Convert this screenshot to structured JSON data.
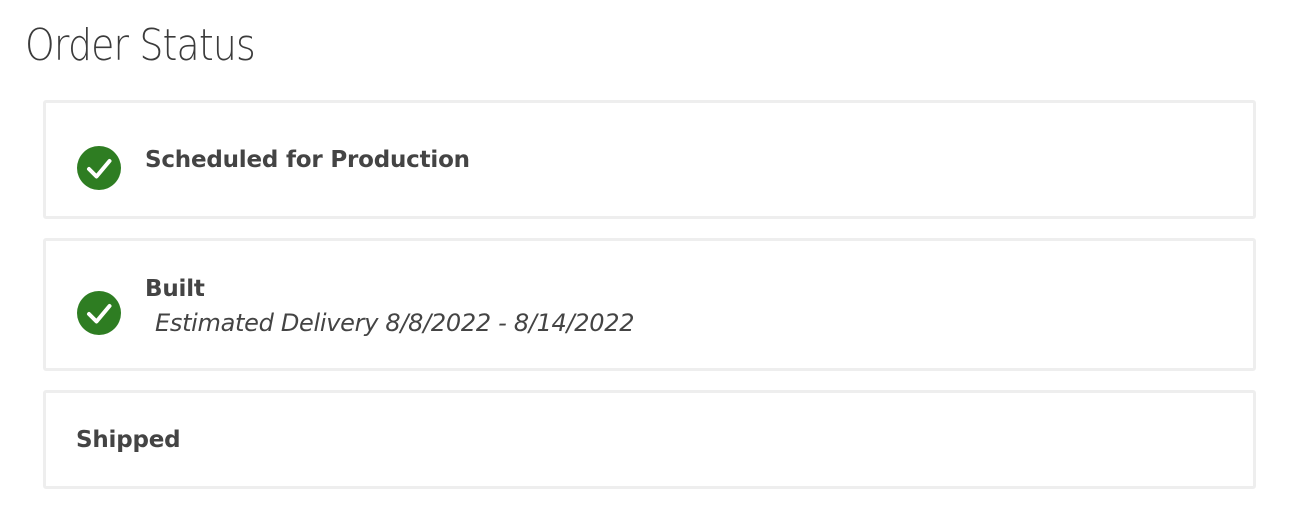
{
  "page": {
    "title": "Order Status"
  },
  "steps": [
    {
      "label": "Scheduled for Production",
      "completed": true,
      "icon": "check-circle-icon"
    },
    {
      "label": "Built",
      "sublabel": "Estimated Delivery 8/8/2022 - 8/14/2022",
      "completed": true,
      "icon": "check-circle-icon"
    },
    {
      "label": "Shipped",
      "completed": false
    }
  ],
  "colors": {
    "check_green": "#2e7d22",
    "text": "#444444",
    "card_border": "#eeeeee"
  }
}
